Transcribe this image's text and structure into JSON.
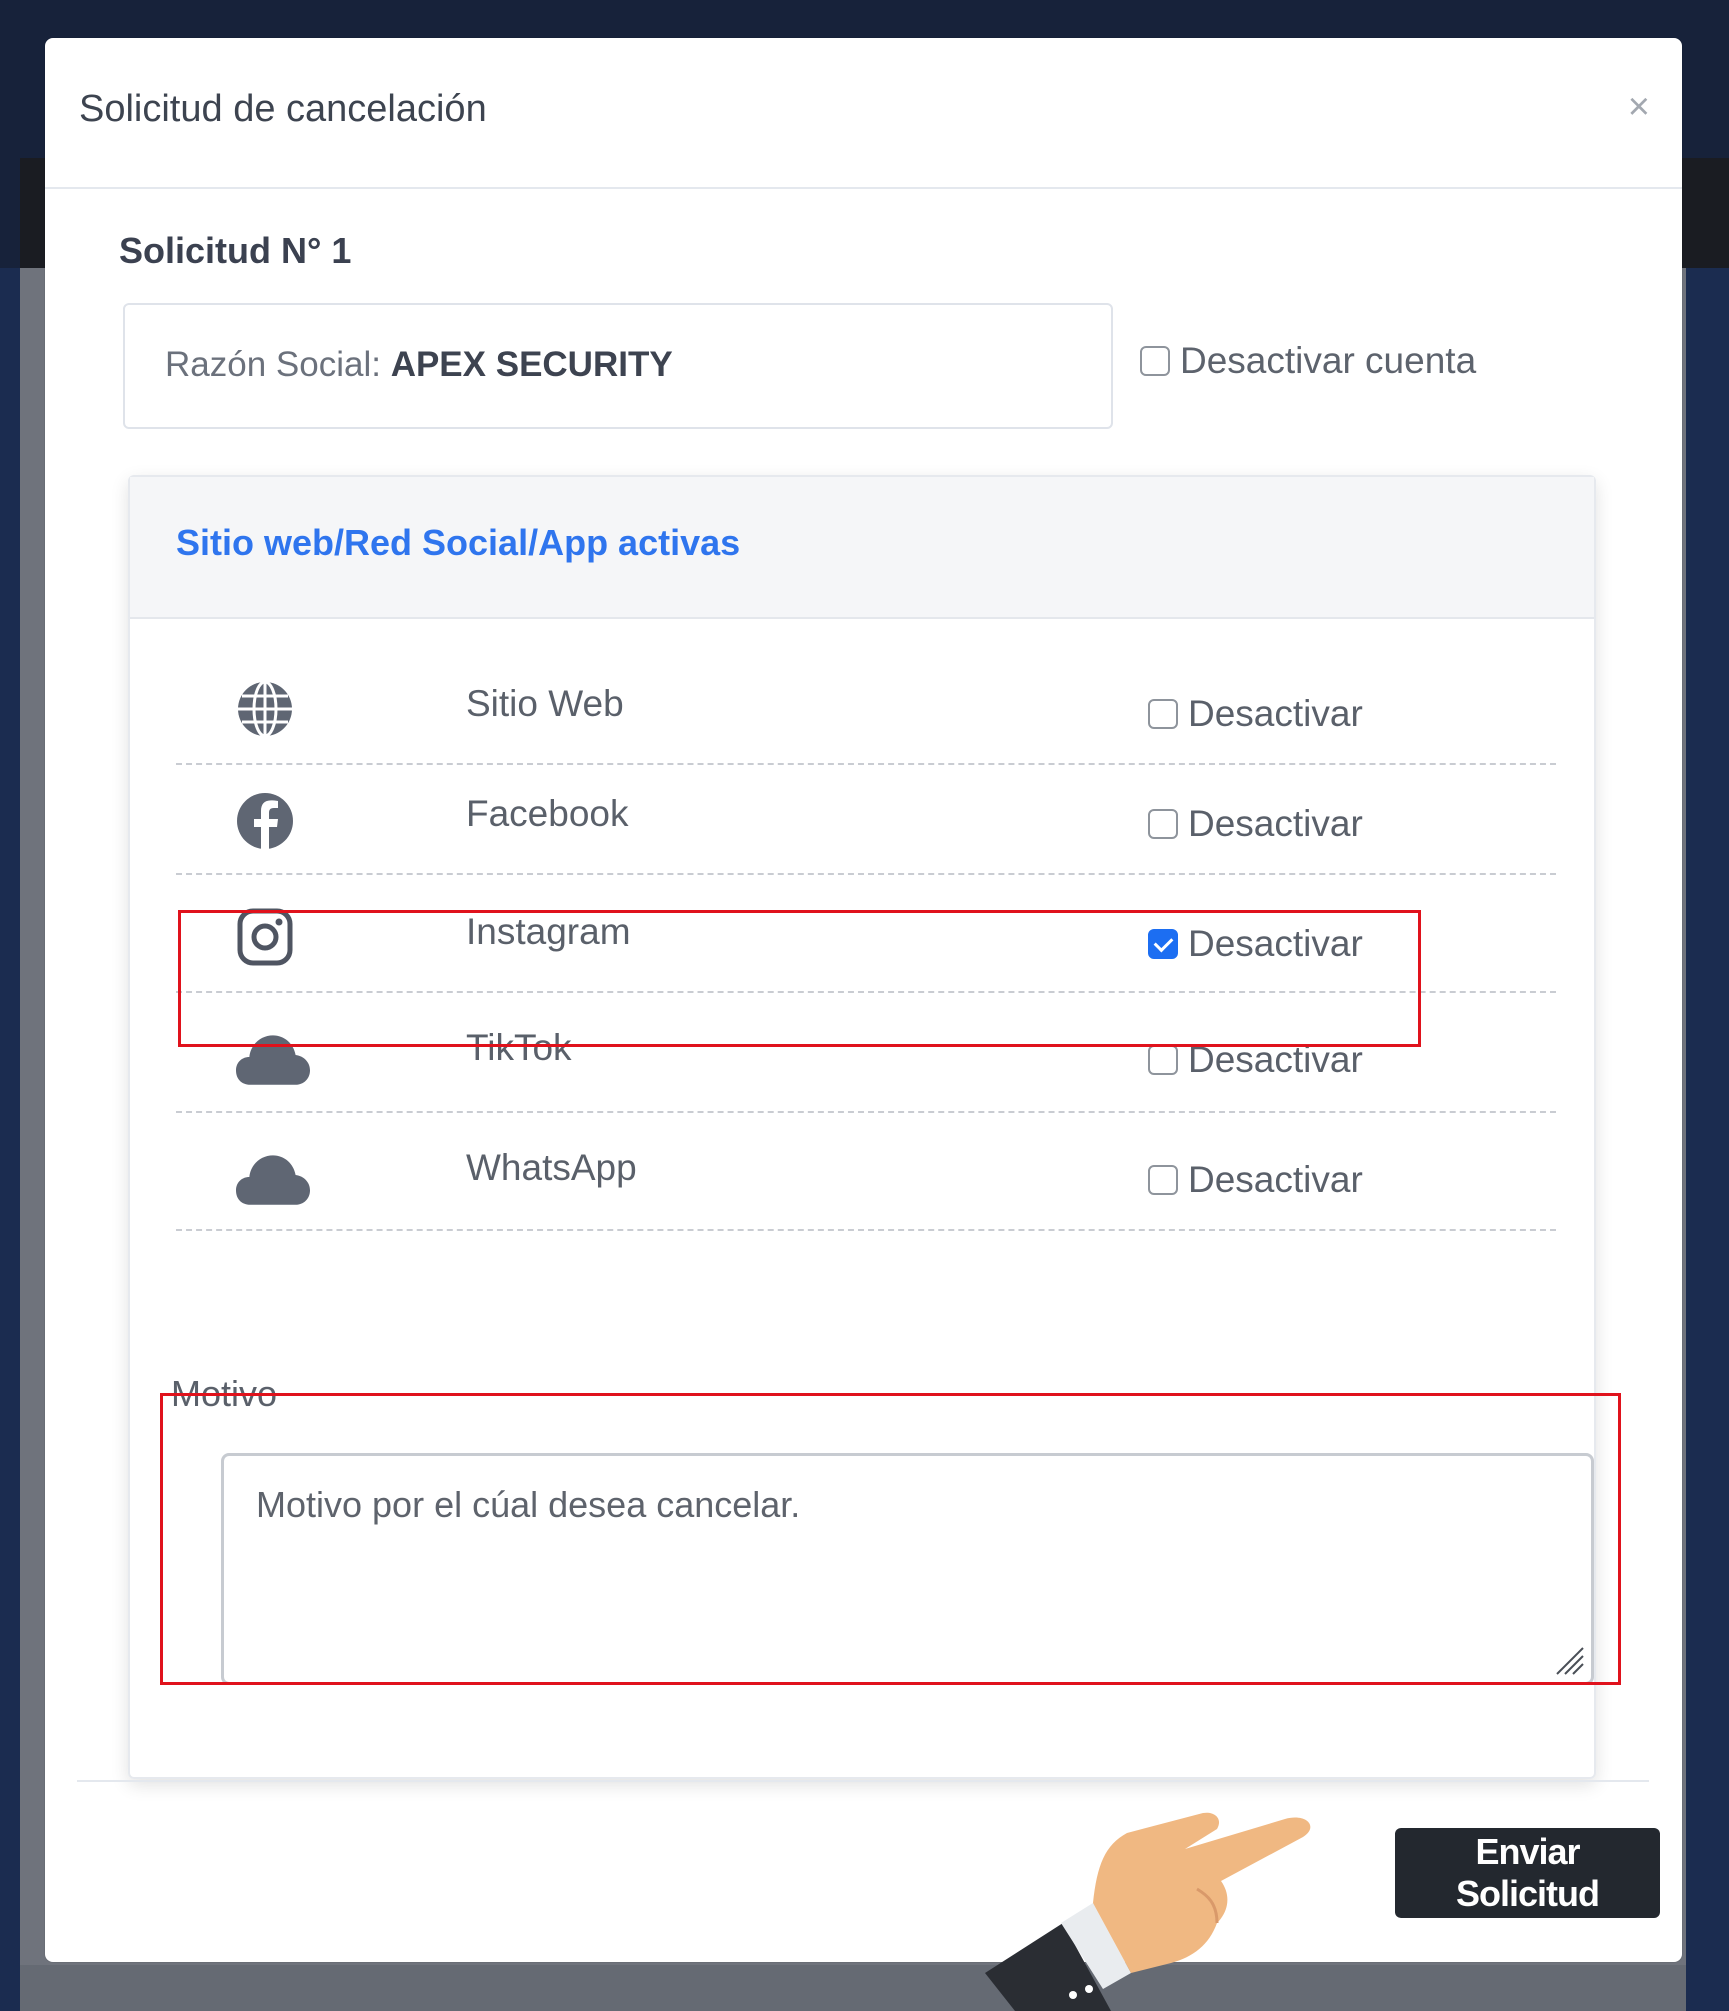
{
  "modal": {
    "title": "Solicitud de cancelación",
    "close_label": "×"
  },
  "request": {
    "number_label": "Solicitud N° 1",
    "razon_label": "Razón Social:",
    "razon_value": "APEX SECURITY",
    "deactivate_account_label": "Desactivar cuenta",
    "deactivate_account_checked": false
  },
  "channels": {
    "title": "Sitio web/Red Social/App activas",
    "items": [
      {
        "name": "Sitio Web",
        "icon": "globe-icon",
        "action_label": "Desactivar",
        "checked": false
      },
      {
        "name": "Facebook",
        "icon": "facebook-icon",
        "action_label": "Desactivar",
        "checked": false
      },
      {
        "name": "Instagram",
        "icon": "instagram-icon",
        "action_label": "Desactivar",
        "checked": true
      },
      {
        "name": "TikTok",
        "icon": "cloud-icon",
        "action_label": "Desactivar",
        "checked": false
      },
      {
        "name": "WhatsApp",
        "icon": "cloud-icon",
        "action_label": "Desactivar",
        "checked": false
      }
    ]
  },
  "motivo": {
    "label": "Motivo",
    "placeholder": "Motivo por el cúal desea cancelar.",
    "value": ""
  },
  "footer": {
    "submit_label": "Enviar Solicitud"
  },
  "colors": {
    "accent": "#1c6ef2",
    "highlight": "#e0121c",
    "button": "#23282f"
  }
}
